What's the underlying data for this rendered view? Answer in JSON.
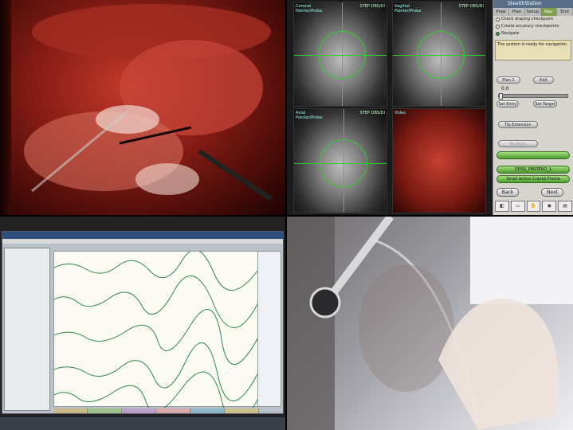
{
  "stealthstation": {
    "title": "StealthStation",
    "tabs": [
      "Prep",
      "Plan",
      "Setup",
      "Nav",
      "End"
    ],
    "active_tab": "Nav",
    "checkpoints": [
      {
        "label": "Check draping checkpoint",
        "selected": false
      },
      {
        "label": "Create accuracy checkpoints",
        "selected": false
      },
      {
        "label": "Navigate",
        "selected": true
      }
    ],
    "status_message": "The system is ready for navigation.",
    "plan_button": "Plan 1",
    "edit_button": "Edit",
    "slider_value": "0.0",
    "set_entry_button": "Set Entry",
    "set_target_button": "Set Target",
    "tip_extension_button": "Tip Extension",
    "re_align_button": "Re-Align",
    "instrument_label": "ZEISS_PENTERO_1",
    "frame_label": "Small Active Cranial Frame",
    "back_button": "Back",
    "next_button": "Next",
    "views": [
      {
        "label": "Coronal",
        "sub": "Pointer/Probe",
        "series": "STEP OBS/DI",
        "name": "coronal"
      },
      {
        "label": "Sagittal",
        "sub": "Pointer/Probe",
        "series": "STEP OBS/DI",
        "name": "sagittal"
      },
      {
        "label": "Axial",
        "sub": "Pointer/Probe",
        "series": "STEP OBS/DI",
        "name": "axial"
      },
      {
        "label": "Video",
        "sub": "",
        "series": "",
        "name": "video"
      }
    ],
    "accent_color": "#7fa04a"
  }
}
